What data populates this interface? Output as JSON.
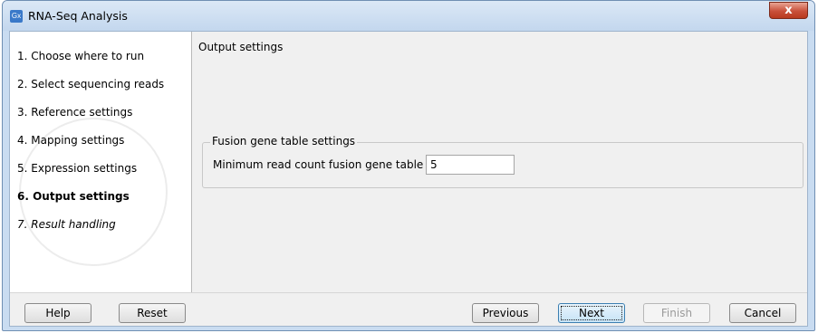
{
  "window": {
    "title": "RNA-Seq Analysis",
    "icon_label": "Gx",
    "close_glyph": "x"
  },
  "steps": [
    {
      "label": "1.  Choose where to run",
      "state": "normal"
    },
    {
      "label": "2.  Select sequencing reads",
      "state": "normal"
    },
    {
      "label": "3.  Reference settings",
      "state": "normal"
    },
    {
      "label": "4.  Mapping settings",
      "state": "normal"
    },
    {
      "label": "5.  Expression settings",
      "state": "normal"
    },
    {
      "label": "6.  Output settings",
      "state": "active"
    },
    {
      "label": "7.  Result handling",
      "state": "italic"
    }
  ],
  "content": {
    "title": "Output settings",
    "group": {
      "legend": "Fusion gene table settings",
      "field_label": "Minimum read count fusion gene table",
      "field_value": "5"
    }
  },
  "buttons": {
    "help": "Help",
    "reset": "Reset",
    "previous": "Previous",
    "next": "Next",
    "finish": "Finish",
    "cancel": "Cancel"
  },
  "colors": {
    "window_frame": "#c9dcf1",
    "close_button": "#c9503a",
    "default_button": "#c6e3f7"
  }
}
